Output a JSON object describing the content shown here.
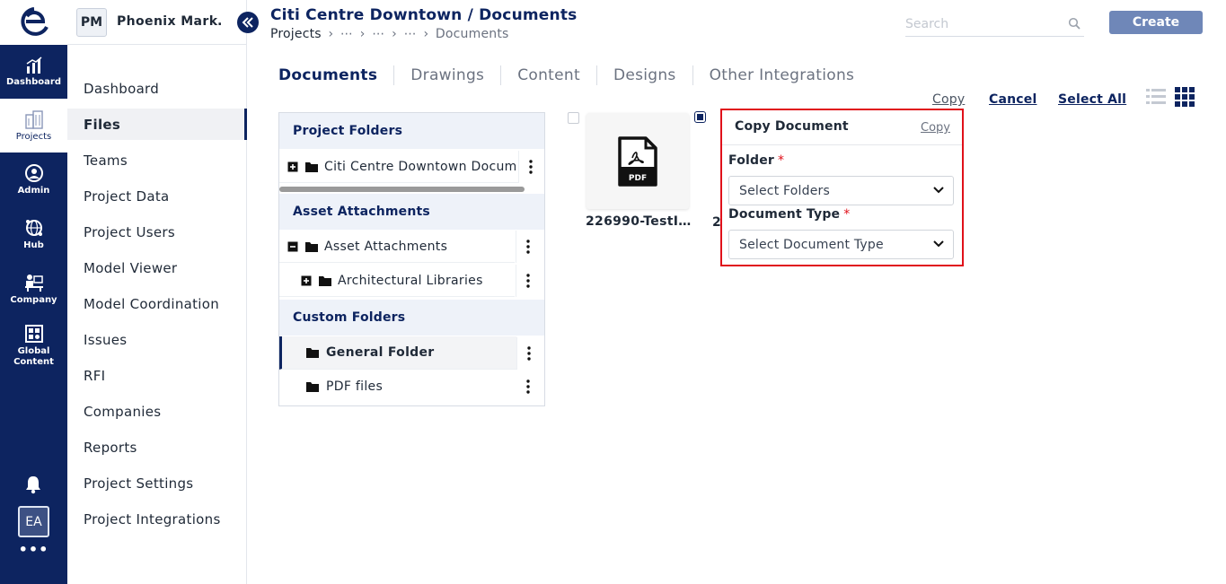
{
  "rail": {
    "items": [
      {
        "label": "Dashboard",
        "icon": "dashboard-chart-icon"
      },
      {
        "label": "Projects",
        "icon": "projects-building-icon",
        "active": true
      },
      {
        "label": "Admin",
        "icon": "admin-user-icon"
      },
      {
        "label": "Hub",
        "icon": "hub-globe-icon"
      },
      {
        "label": "Company",
        "icon": "company-desk-icon"
      },
      {
        "label": "Global Content",
        "icon": "global-content-icon"
      }
    ],
    "avatar": "EA",
    "more": "•••"
  },
  "project": {
    "badge": "PM",
    "name": "Phoenix Mark…"
  },
  "project_nav": [
    "Dashboard",
    "Files",
    "Teams",
    "Project Data",
    "Project Users",
    "Model Viewer",
    "Model Coordination",
    "Issues",
    "RFI",
    "Companies",
    "Reports",
    "Project Settings",
    "Project Integrations"
  ],
  "header": {
    "title": "Citi Centre Downtown / Documents",
    "breadcrumb": {
      "root": "Projects",
      "ellipsis": "⋯",
      "current": "Documents"
    },
    "search_placeholder": "Search",
    "create_label": "Create"
  },
  "tabs": [
    "Documents",
    "Drawings",
    "Content",
    "Designs",
    "Other Integrations"
  ],
  "actions": {
    "copy": "Copy",
    "cancel": "Cancel",
    "select_all": "Select All"
  },
  "folders": {
    "project_folders_title": "Project Folders",
    "project_folder_row": "Citi Centre Downtown Documents",
    "asset_title": "Asset Attachments",
    "asset_row": "Asset Attachments",
    "asset_child": "Architectural Libraries",
    "custom_title": "Custom Folders",
    "custom_rows": [
      "General Folder",
      "PDF files"
    ]
  },
  "documents": [
    {
      "name": "226990-TestI…",
      "type_label": "PDF",
      "checked": false
    },
    {
      "name": "2",
      "checked": true
    }
  ],
  "copy_popup": {
    "title": "Copy Document",
    "copy_link": "Copy",
    "folder_label": "Folder",
    "folder_placeholder": "Select Folders",
    "doctype_label": "Document Type",
    "doctype_placeholder": "Select Document Type",
    "required_mark": "*",
    "border_color": "#e0101a"
  },
  "colors": {
    "brand_navy": "#0d2460",
    "create_button": "#6f87b8",
    "required": "#e0101a"
  }
}
